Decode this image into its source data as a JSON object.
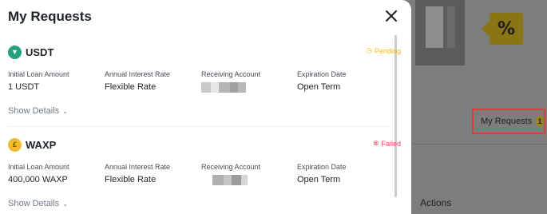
{
  "background": {
    "percent_symbol": "%",
    "my_requests_label": "My Requests",
    "my_requests_count": "1",
    "actions_label": "Actions"
  },
  "panel": {
    "title": "My Requests",
    "close_icon": "close-icon"
  },
  "requests": [
    {
      "coin": "USDT",
      "coin_icon": "usdt-coin-icon",
      "coin_color": "#26a17b",
      "status": "Pending",
      "status_color": "#f0b90b",
      "status_icon": "clock-icon",
      "fields": {
        "initial_loan_label": "Initial Loan Amount",
        "initial_loan_value": "1 USDT",
        "interest_label": "Annual Interest Rate",
        "interest_value": "Flexible Rate",
        "account_label": "Receiving Account",
        "account_value_masked": true,
        "expiration_label": "Expiration Date",
        "expiration_value": "Open Term"
      },
      "show_details": "Show Details"
    },
    {
      "coin": "WAXP",
      "coin_icon": "waxp-coin-icon",
      "coin_color": "#f3ba2f",
      "status": "Failed",
      "status_color": "#f6465d",
      "status_icon": "x-circle-icon",
      "fields": {
        "initial_loan_label": "Initial Loan Amount",
        "initial_loan_value": "400,000 WAXP",
        "interest_label": "Annual Interest Rate",
        "interest_value": "Flexible Rate",
        "account_label": "Receiving Account",
        "account_value_masked": true,
        "expiration_label": "Expiration Date",
        "expiration_value": "Open Term"
      },
      "show_details": "Show Details"
    }
  ]
}
